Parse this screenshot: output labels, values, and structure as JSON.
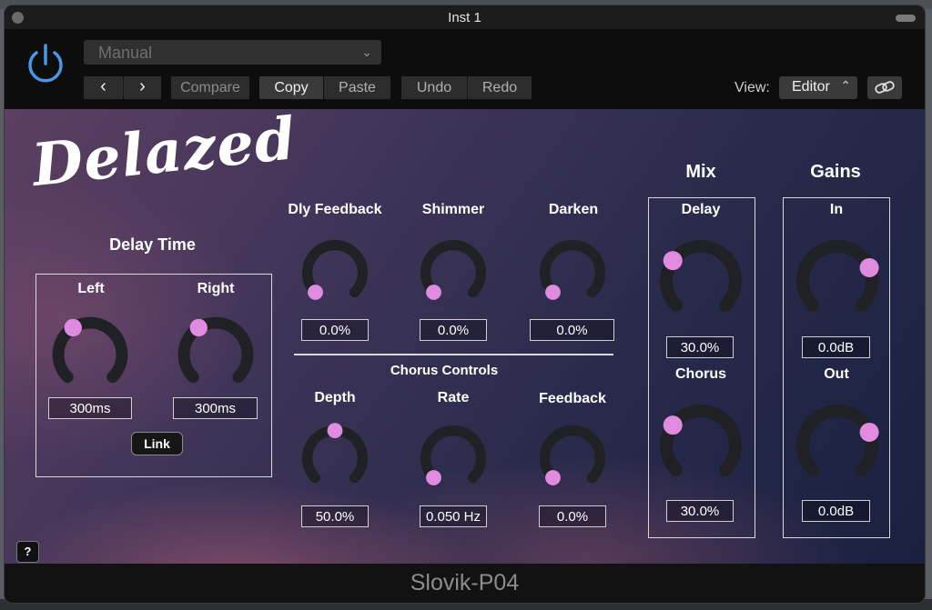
{
  "window": {
    "title": "Inst 1"
  },
  "header": {
    "preset": "Manual",
    "buttons": {
      "prev": "‹",
      "next": "›",
      "compare": "Compare",
      "copy": "Copy",
      "paste": "Paste",
      "undo": "Undo",
      "redo": "Redo"
    },
    "view_label": "View:",
    "view_value": "Editor"
  },
  "colors": {
    "accent": "#e08ae0",
    "knob_track": "#1f2125",
    "power": "#4a97e8"
  },
  "plugin": {
    "logo": "Delazed",
    "delay_time": {
      "title": "Delay Time",
      "left": {
        "label": "Left",
        "value": "300ms",
        "level": 0.38
      },
      "right": {
        "label": "Right",
        "value": "300ms",
        "level": 0.38
      },
      "link_label": "Link"
    },
    "effects": {
      "dly_feedback": {
        "label": "Dly Feedback",
        "value": "0.0%",
        "level": 0.0
      },
      "shimmer": {
        "label": "Shimmer",
        "value": "0.0%",
        "level": 0.0
      },
      "darken": {
        "label": "Darken",
        "value": "0.0%",
        "level": 0.0
      }
    },
    "chorus": {
      "title": "Chorus Controls",
      "depth": {
        "label": "Depth",
        "value": "50.0%",
        "level": 0.5
      },
      "rate": {
        "label": "Rate",
        "value": "0.050 Hz",
        "level": 0.0
      },
      "feedback": {
        "label": "Feedback",
        "value": "0.0%",
        "level": 0.0
      }
    },
    "mix": {
      "title": "Mix",
      "delay": {
        "label": "Delay",
        "value": "30.0%",
        "level": 0.3
      },
      "chorus": {
        "label": "Chorus",
        "value": "30.0%",
        "level": 0.3
      }
    },
    "gains": {
      "title": "Gains",
      "in": {
        "label": "In",
        "value": "0.0dB",
        "level": 0.75
      },
      "out": {
        "label": "Out",
        "value": "0.0dB",
        "level": 0.75
      }
    },
    "help_label": "?"
  },
  "footer": {
    "text": "Slovik-P04"
  }
}
